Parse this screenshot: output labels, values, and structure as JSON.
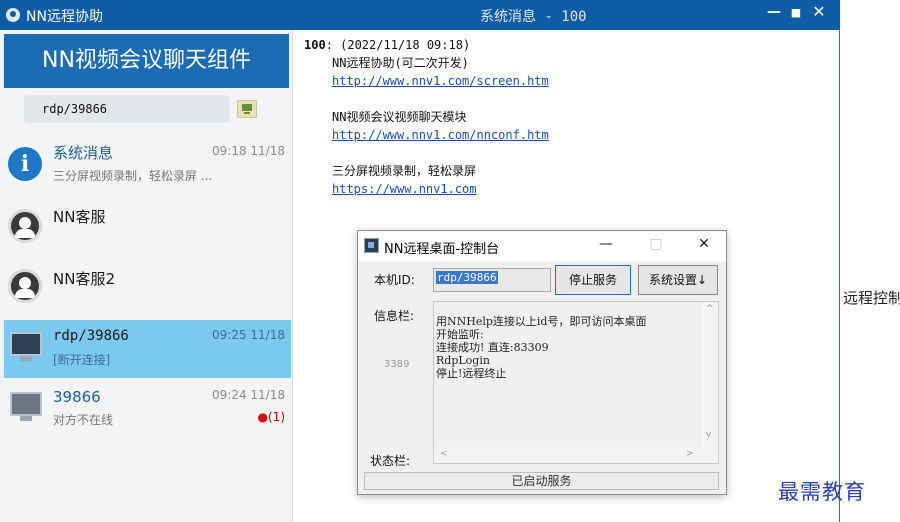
{
  "titlebar": {
    "app_title": "NN远程协助",
    "center_title": "系统消息 - 100",
    "min_glyph": "—",
    "max_glyph": "■",
    "close_glyph": "✕"
  },
  "sidebar": {
    "banner": "NN视频会议聊天组件",
    "search_value": "rdp/39866",
    "contacts": [
      {
        "name": "系统消息",
        "time": "09:18 11/18",
        "sub": "三分屏视频录制，轻松录屏 ...",
        "avatar": "info-icon",
        "avatar_glyph": "i"
      },
      {
        "name": "NN客服",
        "avatar": "customer-service-icon"
      },
      {
        "name": "NN客服2",
        "avatar": "customer-service-icon"
      },
      {
        "name": "rdp/39866",
        "time": "09:25 11/18",
        "sub": "[断开连接]",
        "avatar": "monitor-icon"
      },
      {
        "name": "39866",
        "time": "09:24 11/18",
        "sub": "对方不在线",
        "badge_dot": "●",
        "badge": "(1)",
        "avatar": "monitor-icon"
      }
    ]
  },
  "message": {
    "id": "100",
    "date": ": (2022/11/18 09:18)",
    "lines": [
      {
        "text": "NN远程协助(可二次开发)",
        "link": "http://www.nnv1.com/screen.htm"
      },
      {
        "text": "NN视频会议视频聊天模块",
        "link": "http://www.nnv1.com/nnconf.htm"
      },
      {
        "text": "三分屏视频录制，轻松录屏",
        "link": "https://www.nnv1.com"
      }
    ]
  },
  "dialog": {
    "title": "NN远程桌面-控制台",
    "min_glyph": "—",
    "max_glyph": "□",
    "close_glyph": "✕",
    "id_label": "本机ID:",
    "id_value": "rdp/39866",
    "stop_button": "停止服务",
    "settings_button": "系统设置↓",
    "info_label": "信息栏:",
    "port": "3389",
    "info_text": "用NNHelp连接以上id号，即可访问本桌面\n开始监听:\n连接成功! 直连:83309\nRdpLogin\n停止!远程终止",
    "status_label": "状态栏:",
    "status_value": "已启动服务",
    "scroll_up": "^",
    "scroll_down": "v",
    "scroll_left": "<",
    "scroll_right": ">"
  },
  "background": {
    "clipped_text": "远程控制",
    "watermark": "最需教育"
  },
  "colors": {
    "titlebar": "#0e5ba6",
    "banner": "#1b6cb5",
    "selected_contact": "#7cc8ef",
    "link": "#1a4fb0",
    "badge": "#e00000"
  }
}
